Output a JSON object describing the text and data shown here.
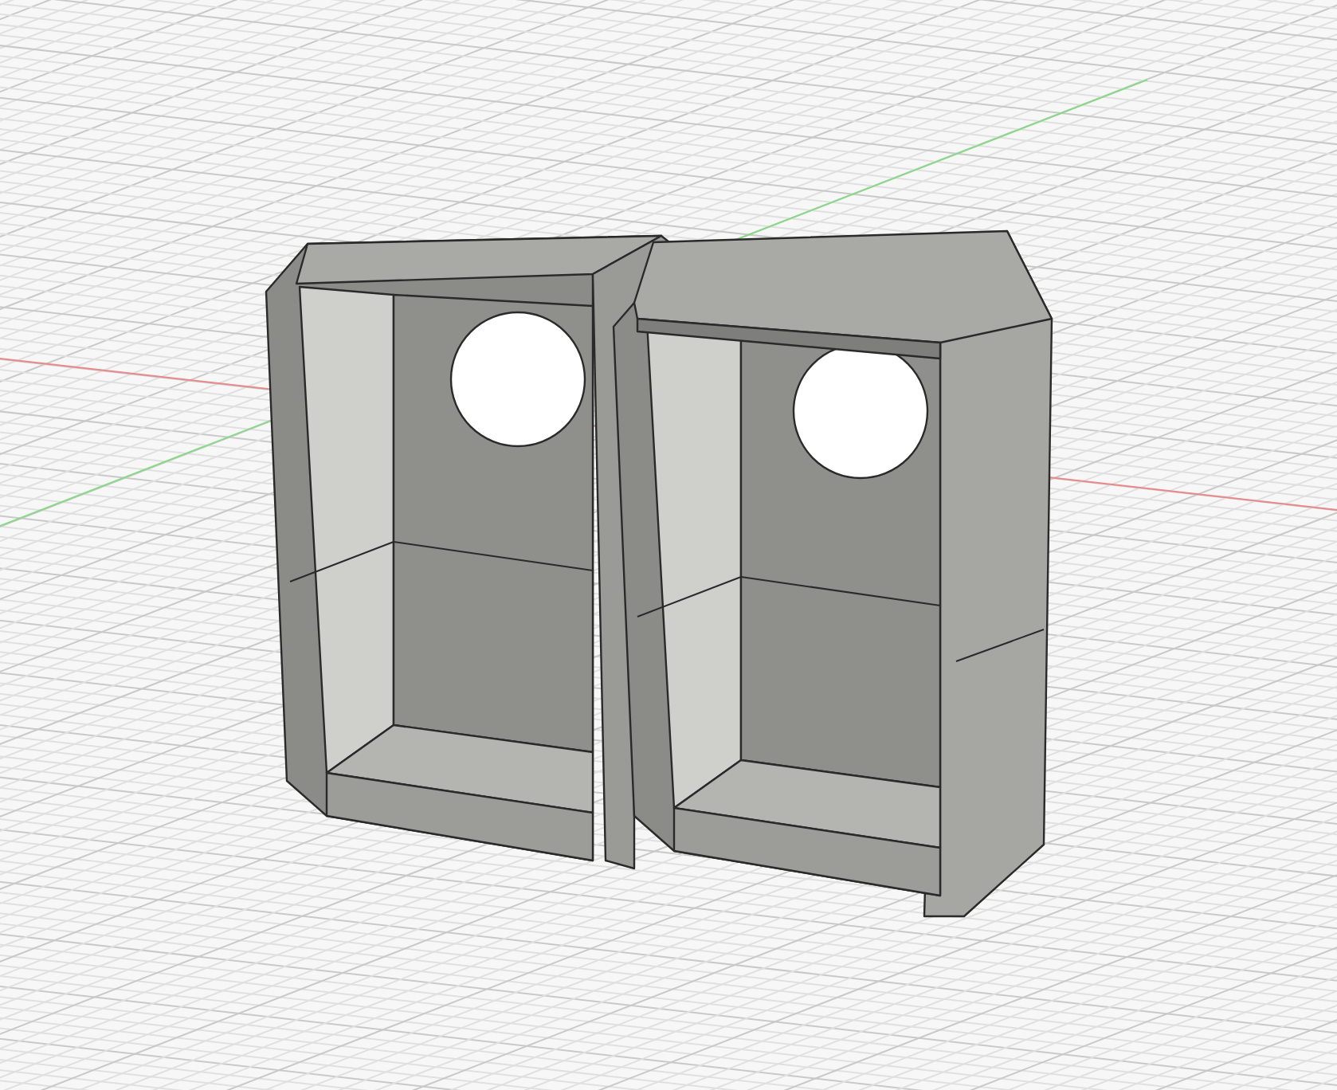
{
  "canvas": {
    "kind": "viewport",
    "show_grid": true,
    "show_axes": true
  }
}
